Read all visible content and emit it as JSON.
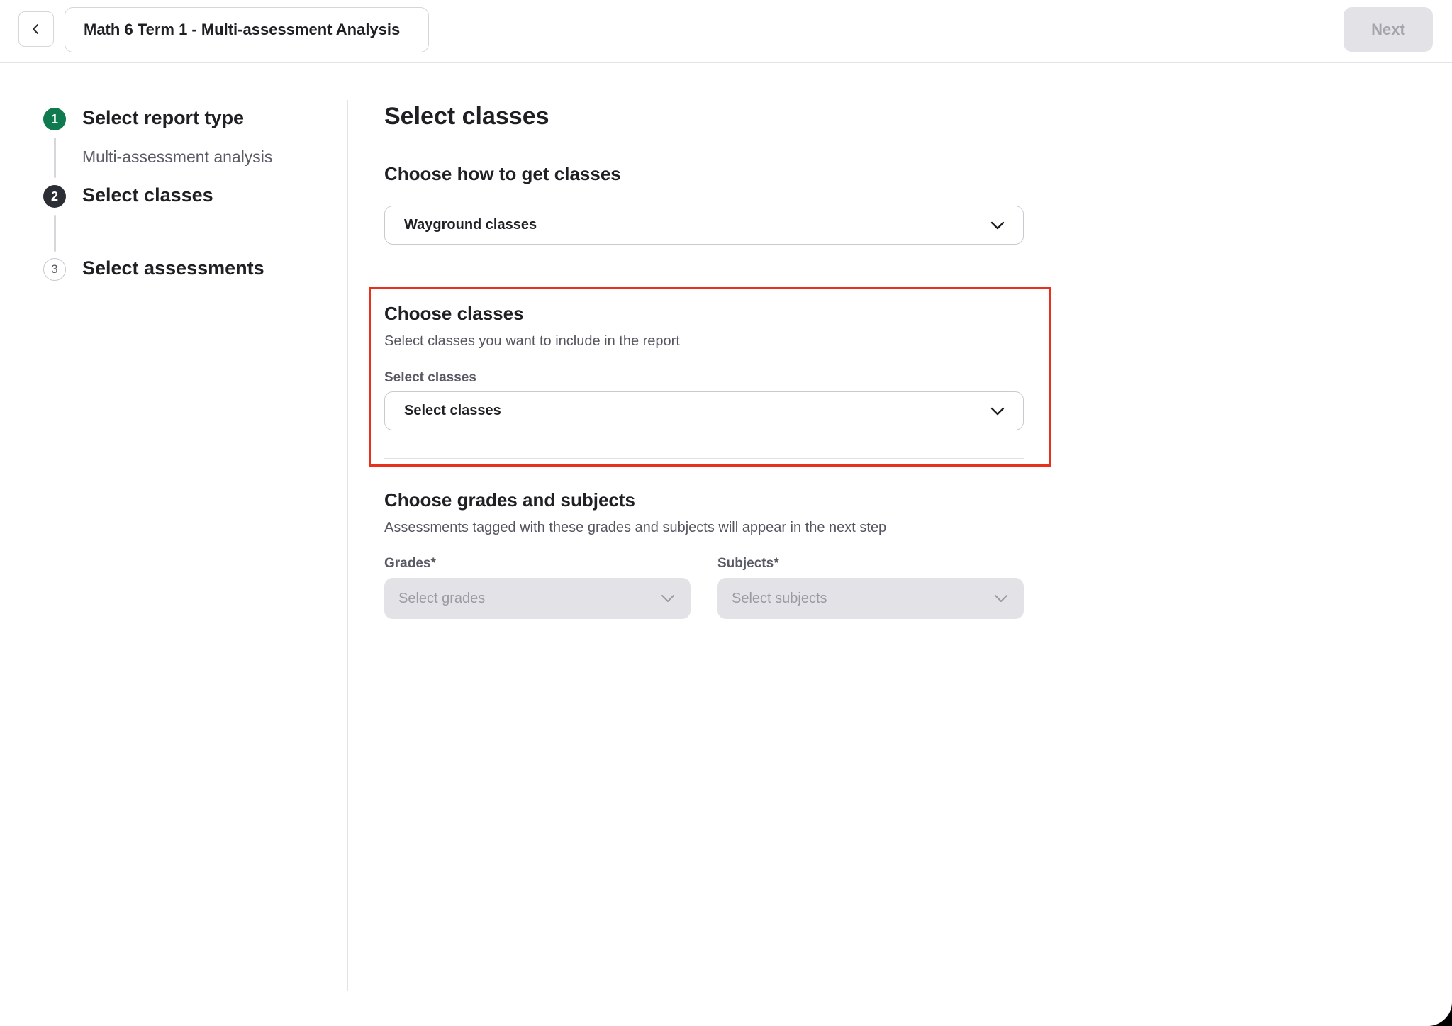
{
  "header": {
    "title": "Math 6 Term 1 - Multi-assessment Analysis",
    "next_label": "Next"
  },
  "stepper": {
    "steps": [
      {
        "number": "1",
        "title": "Select report type",
        "subtitle": "Multi-assessment analysis",
        "status": "completed"
      },
      {
        "number": "2",
        "title": "Select classes",
        "status": "current"
      },
      {
        "number": "3",
        "title": "Select assessments",
        "status": "upcoming"
      }
    ]
  },
  "main": {
    "title": "Select classes",
    "source": {
      "title": "Choose how to get classes",
      "selected": "Wayground classes"
    },
    "classes": {
      "title": "Choose classes",
      "description": "Select classes you want to include in the report",
      "label": "Select classes",
      "placeholder": "Select classes"
    },
    "grades_subjects": {
      "title": "Choose grades and subjects",
      "description": "Assessments tagged with these grades and subjects will appear in the next step",
      "grades_label": "Grades*",
      "grades_placeholder": "Select grades",
      "subjects_label": "Subjects*",
      "subjects_placeholder": "Select subjects"
    }
  },
  "colors": {
    "step_complete": "#0e7a4e",
    "step_current": "#2b2e35",
    "highlight": "#e8301f",
    "disabled_bg": "#e3e3e7"
  }
}
